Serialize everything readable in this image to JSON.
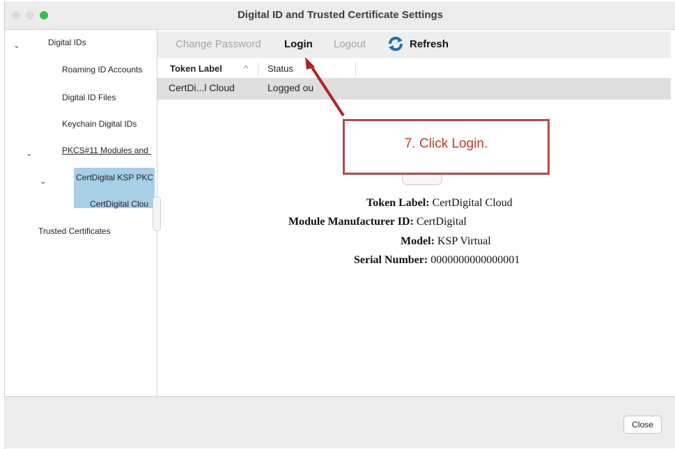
{
  "window": {
    "title": "Digital ID and Trusted Certificate Settings"
  },
  "sidebar": {
    "items": [
      {
        "label": "Digital IDs"
      },
      {
        "label": "Roaming ID Accounts"
      },
      {
        "label": "Digital ID Files"
      },
      {
        "label": "Keychain Digital IDs"
      },
      {
        "label": "PKCS#11 Modules and T"
      },
      {
        "label": "CertDigital KSP PKC"
      },
      {
        "label": "CertDigital Clou"
      },
      {
        "label": "Trusted Certificates"
      }
    ]
  },
  "toolbar": {
    "change_password": "Change Password",
    "login": "Login",
    "logout": "Logout",
    "refresh": "Refresh"
  },
  "table": {
    "columns": [
      "Token Label",
      "Status"
    ],
    "sort_indicator": "^",
    "rows": [
      {
        "token_label": "CertDi...l Cloud",
        "status": "Logged ou"
      }
    ]
  },
  "details": {
    "token_label_key": "Token Label:",
    "token_label_value": "CertDigital Cloud",
    "manufacturer_key": "Module Manufacturer ID:",
    "manufacturer_value": "CertDigital",
    "model_key": "Model:",
    "model_value": "KSP Virtual",
    "serial_key": "Serial Number:",
    "serial_value": "0000000000000001"
  },
  "annotation": {
    "text": "7. Click Login.",
    "color": "#c0392b"
  },
  "footer": {
    "close": "Close"
  },
  "colors": {
    "selection": "#a8cfe8",
    "traffic_green": "#2fc24a",
    "arrow": "#b22222"
  }
}
